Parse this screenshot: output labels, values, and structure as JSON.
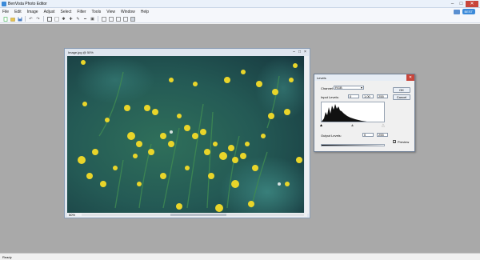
{
  "window": {
    "title": "BenVista Photo Editor",
    "min": "–",
    "max": "□",
    "close": "✕"
  },
  "menu": {
    "items": [
      "File",
      "Edit",
      "Image",
      "Adjust",
      "Select",
      "Filter",
      "Tools",
      "View",
      "Window",
      "Help"
    ],
    "badge": "BEST"
  },
  "toolbar": {
    "icons": [
      "new-icon",
      "open-icon",
      "save-icon",
      "undo-icon",
      "redo-icon",
      "crop-icon",
      "select-icon",
      "zoom-icon",
      "move-icon",
      "brush-icon",
      "line-icon",
      "rect-icon",
      "frame-icon",
      "grid-icon",
      "panel-icon",
      "info-icon"
    ]
  },
  "document": {
    "title": "Image.jpg @ 50%",
    "zoom": "50%",
    "colors": {
      "bg_dark": "#1f3f3e",
      "accent": "#e9d52a"
    }
  },
  "levels": {
    "title": "Levels",
    "channel_label": "Channel:",
    "channel_value": "RGB",
    "input_label": "Input Levels:",
    "input_black": "0",
    "input_gamma": "1.00",
    "input_white": "255",
    "output_label": "Output Levels:",
    "output_black": "0",
    "output_white": "255",
    "ok": "OK",
    "cancel": "Cancel",
    "preview_label": "Preview",
    "preview_checked": true
  },
  "status": {
    "text": "Ready"
  }
}
